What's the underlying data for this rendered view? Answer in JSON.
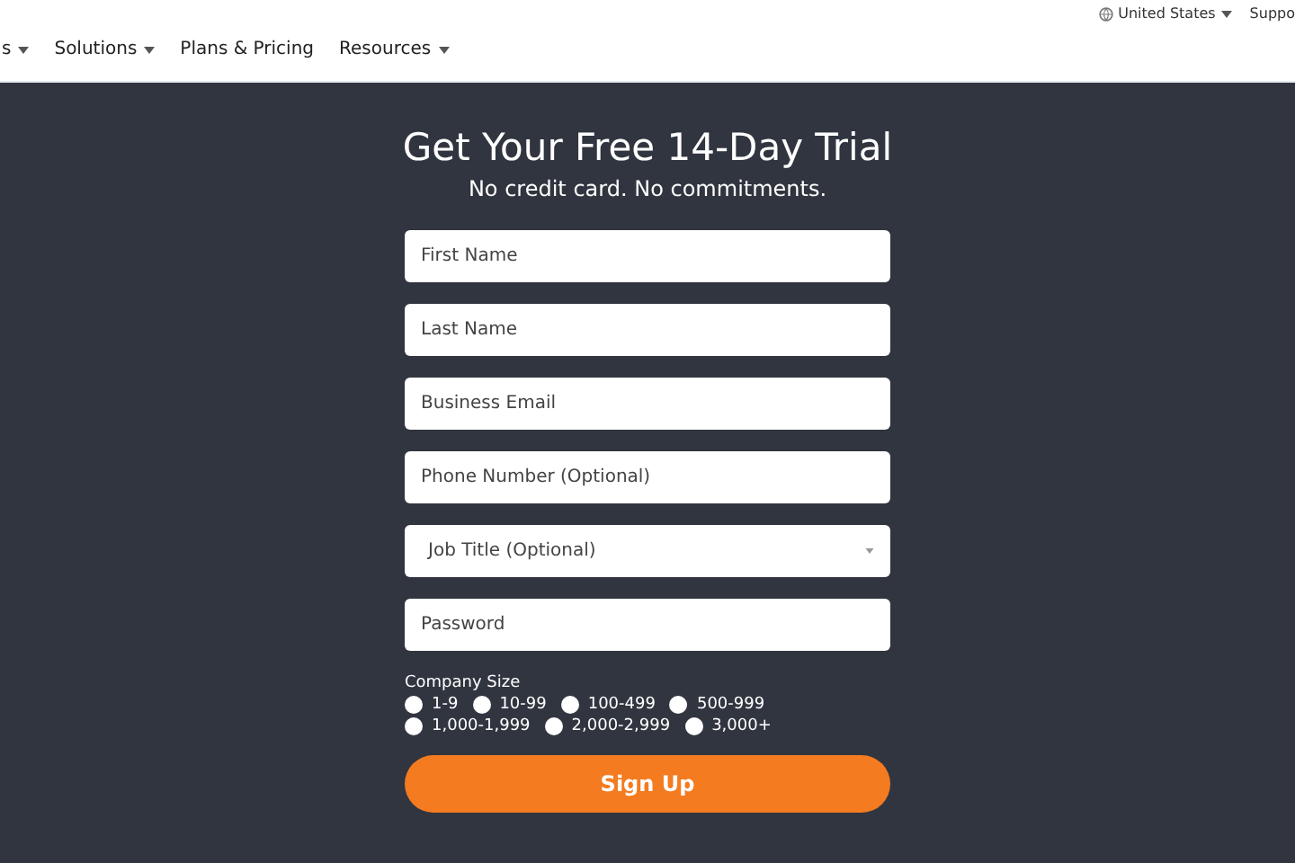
{
  "utility_bar": {
    "region": "United States",
    "support": "Suppo"
  },
  "nav": [
    {
      "label": "s",
      "dropdown": true
    },
    {
      "label": "Solutions",
      "dropdown": true
    },
    {
      "label": "Plans & Pricing",
      "dropdown": false
    },
    {
      "label": "Resources",
      "dropdown": true
    }
  ],
  "form": {
    "title": "Get Your Free 14-Day Trial",
    "subtitle": "No credit card. No commitments.",
    "fields": [
      {
        "kind": "input",
        "placeholder": "First Name"
      },
      {
        "kind": "input",
        "placeholder": "Last Name"
      },
      {
        "kind": "input",
        "placeholder": "Business Email"
      },
      {
        "kind": "input",
        "placeholder": "Phone Number (Optional)"
      },
      {
        "kind": "select",
        "placeholder": "Job Title (Optional)"
      },
      {
        "kind": "password",
        "placeholder": "Password"
      }
    ],
    "company_size": {
      "label": "Company Size",
      "options": [
        {
          "label": "1-9",
          "selected": false
        },
        {
          "label": "10-99",
          "selected": false
        },
        {
          "label": "100-499",
          "selected": false
        },
        {
          "label": "500-999",
          "selected": false
        },
        {
          "label": "1,000-1,999",
          "selected": false
        },
        {
          "label": "2,000-2,999",
          "selected": false
        },
        {
          "label": "3,000+",
          "selected": false
        }
      ]
    },
    "submit": "Sign Up"
  }
}
